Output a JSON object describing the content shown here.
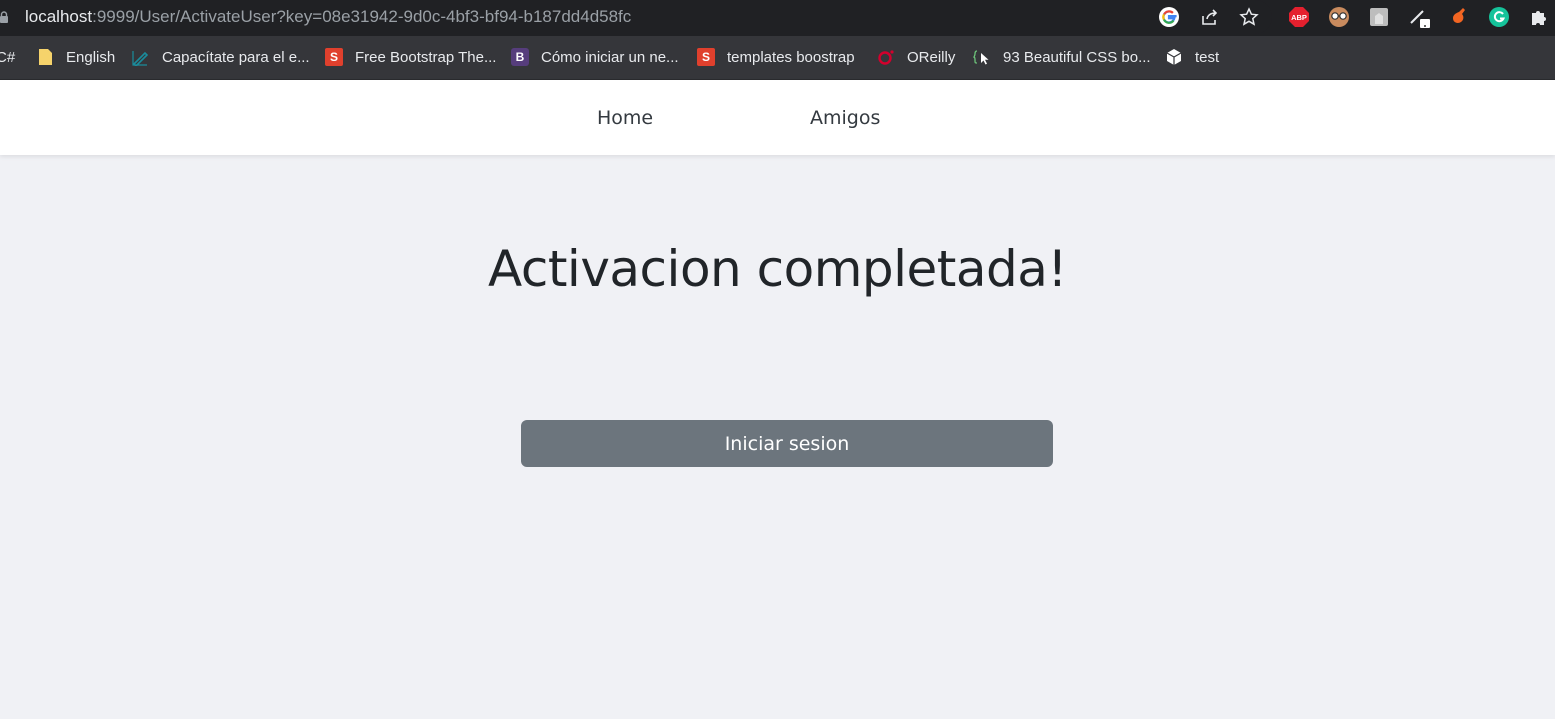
{
  "browser": {
    "url_host": "localhost",
    "url_rest": ":9999/User/ActivateUser?key=08e31942-9d0c-4bf3-bf94-b187dd4d58fc",
    "bookmarks": [
      {
        "label": "C#",
        "icon": "partial-bookmark"
      },
      {
        "label": "English",
        "icon": "folder-icon"
      },
      {
        "label": "Capacítate para el e...",
        "icon": "edit-pen-icon"
      },
      {
        "label": "Free Bootstrap The...",
        "icon": "s-logo-icon",
        "icon_text": "S"
      },
      {
        "label": "Cómo iniciar un ne...",
        "icon": "bootstrap-logo-icon",
        "icon_text": "B"
      },
      {
        "label": "templates boostrap",
        "icon": "s-logo-icon",
        "icon_text": "S"
      },
      {
        "label": "OReilly",
        "icon": "oreilly-icon"
      },
      {
        "label": "93 Beautiful CSS bo...",
        "icon": "code-cursor-icon"
      },
      {
        "label": "test",
        "icon": "cube-icon"
      }
    ],
    "extensions": {
      "abp_label": "ABP"
    }
  },
  "nav": {
    "home": "Home",
    "friends": "Amigos"
  },
  "main": {
    "title": "Activacion completada!",
    "login_button": "Iniciar sesion"
  },
  "colors": {
    "button": "#6c757d",
    "page_bg": "#f0f1f5",
    "navbar_bg": "#ffffff"
  }
}
